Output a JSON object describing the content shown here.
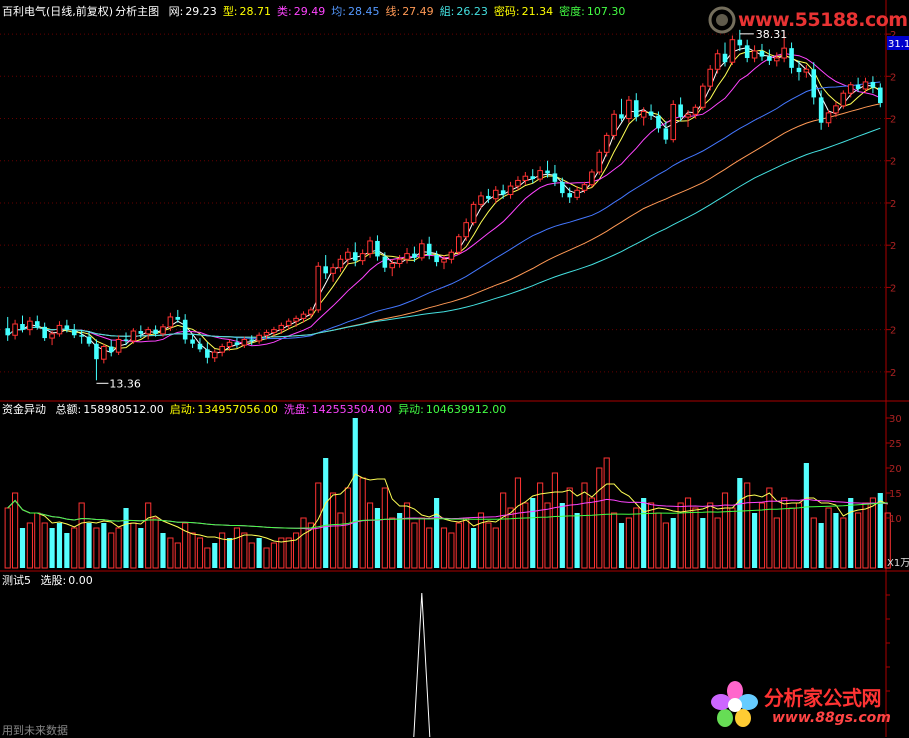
{
  "watermark_top": {
    "site": "www.55188.com"
  },
  "watermark_bottom": {
    "brand": "分析家公式网",
    "site": "www.88gs.com"
  },
  "panels": {
    "main": {
      "title": "百利电气(日线,前复权)",
      "subtitle": "分析主图",
      "indicators": [
        {
          "label": "网:",
          "value": "29.23",
          "color": "#ffffff"
        },
        {
          "label": "型:",
          "value": "28.71",
          "color": "#ffff00"
        },
        {
          "label": "类:",
          "value": "29.49",
          "color": "#ff44ff"
        },
        {
          "label": "均:",
          "value": "28.45",
          "color": "#5599ff"
        },
        {
          "label": "线:",
          "value": "27.49",
          "color": "#ff9955"
        },
        {
          "label": "組:",
          "value": "26.23",
          "color": "#44e0e0"
        },
        {
          "label": "密码:",
          "value": "21.34",
          "color": "#ffff00"
        },
        {
          "label": "密度:",
          "value": "107.30",
          "color": "#44ff44"
        }
      ],
      "high_marker": "38.31",
      "low_marker": "13.36",
      "price_tag": "31.1"
    },
    "volume": {
      "title": "资金异动",
      "indicators": [
        {
          "label": "总额:",
          "value": "158980512.00",
          "color": "#ffffff"
        },
        {
          "label": "启动:",
          "value": "134957056.00",
          "color": "#ffff00"
        },
        {
          "label": "洗盘:",
          "value": "142553504.00",
          "color": "#ff44ff"
        },
        {
          "label": "异动:",
          "value": "104639912.00",
          "color": "#44ff44"
        }
      ],
      "axis_ticks": [
        "30",
        "25",
        "20",
        "15",
        "10"
      ],
      "unit_label": "X1万"
    },
    "signal": {
      "title": "测试5",
      "indicators": [
        {
          "label": "选股:",
          "value": "0.00",
          "color": "#ffffff"
        }
      ],
      "footer_text": "用到未来数据"
    }
  },
  "chart_data": [
    {
      "type": "candlestick",
      "title": "百利电气(日线,前复权)",
      "price_range": [
        12,
        39
      ],
      "annotations": [
        {
          "label": "38.31",
          "kind": "high"
        },
        {
          "label": "13.36",
          "kind": "low"
        }
      ],
      "series": [
        {
          "name": "网",
          "last": 29.23
        },
        {
          "name": "型",
          "last": 28.71
        },
        {
          "name": "类",
          "last": 29.49
        },
        {
          "name": "均",
          "last": 28.45
        },
        {
          "name": "线",
          "last": 27.49
        },
        {
          "name": "組",
          "last": 26.23
        }
      ],
      "ohlc": [
        [
          17.1,
          17.9,
          16.2,
          16.6
        ],
        [
          16.6,
          17.7,
          16.3,
          17.4
        ],
        [
          17.4,
          18.0,
          16.8,
          17.0
        ],
        [
          17.0,
          17.9,
          16.6,
          17.6
        ],
        [
          17.6,
          18.0,
          17.0,
          17.2
        ],
        [
          17.2,
          17.5,
          16.2,
          16.4
        ],
        [
          16.4,
          16.9,
          15.9,
          16.7
        ],
        [
          16.7,
          17.6,
          16.5,
          17.3
        ],
        [
          17.3,
          17.7,
          16.8,
          17.0
        ],
        [
          17.0,
          17.4,
          16.4,
          16.6
        ],
        [
          16.6,
          17.0,
          16.0,
          16.5
        ],
        [
          16.5,
          16.9,
          15.8,
          16.0
        ],
        [
          16.0,
          16.3,
          13.4,
          14.9
        ],
        [
          14.9,
          16.0,
          14.6,
          15.8
        ],
        [
          15.8,
          16.3,
          15.1,
          15.4
        ],
        [
          15.4,
          16.6,
          15.2,
          16.3
        ],
        [
          16.3,
          16.8,
          15.9,
          16.2
        ],
        [
          16.2,
          17.1,
          16.0,
          16.9
        ],
        [
          16.9,
          17.3,
          16.4,
          16.7
        ],
        [
          16.7,
          17.2,
          16.3,
          17.0
        ],
        [
          17.0,
          17.3,
          16.5,
          16.7
        ],
        [
          16.7,
          17.4,
          16.5,
          17.2
        ],
        [
          17.2,
          18.2,
          16.9,
          17.9
        ],
        [
          17.9,
          18.4,
          17.5,
          17.7
        ],
        [
          17.7,
          18.1,
          16.0,
          16.3
        ],
        [
          16.3,
          16.7,
          15.7,
          16.0
        ],
        [
          16.0,
          16.4,
          15.4,
          15.6
        ],
        [
          15.6,
          16.1,
          14.6,
          15.0
        ],
        [
          15.0,
          15.6,
          14.7,
          15.4
        ],
        [
          15.4,
          16.0,
          15.1,
          15.8
        ],
        [
          15.8,
          16.3,
          15.5,
          16.1
        ],
        [
          16.1,
          16.4,
          15.7,
          15.9
        ],
        [
          15.9,
          16.5,
          15.7,
          16.3
        ],
        [
          16.3,
          16.6,
          15.9,
          16.2
        ],
        [
          16.2,
          16.8,
          16.0,
          16.6
        ],
        [
          16.6,
          17.0,
          16.3,
          16.8
        ],
        [
          16.8,
          17.2,
          16.5,
          17.0
        ],
        [
          17.0,
          17.5,
          16.7,
          17.3
        ],
        [
          17.3,
          17.8,
          17.0,
          17.6
        ],
        [
          17.6,
          18.0,
          17.2,
          17.8
        ],
        [
          17.8,
          18.3,
          17.5,
          18.1
        ],
        [
          18.1,
          18.6,
          17.8,
          18.4
        ],
        [
          18.4,
          21.8,
          18.2,
          21.5
        ],
        [
          21.5,
          22.3,
          20.6,
          21.0
        ],
        [
          21.0,
          21.7,
          20.4,
          21.4
        ],
        [
          21.4,
          22.3,
          21.1,
          22.0
        ],
        [
          22.0,
          22.8,
          21.6,
          22.5
        ],
        [
          22.5,
          23.2,
          21.5,
          21.9
        ],
        [
          21.9,
          22.7,
          21.6,
          22.4
        ],
        [
          22.4,
          23.6,
          22.1,
          23.3
        ],
        [
          23.3,
          23.7,
          21.9,
          22.2
        ],
        [
          22.2,
          22.5,
          21.1,
          21.4
        ],
        [
          21.4,
          22.0,
          20.8,
          21.7
        ],
        [
          21.7,
          22.3,
          21.4,
          22.0
        ],
        [
          22.0,
          22.8,
          21.7,
          22.4
        ],
        [
          22.4,
          22.9,
          21.8,
          22.1
        ],
        [
          22.1,
          23.4,
          21.9,
          23.1
        ],
        [
          23.1,
          23.6,
          22.0,
          22.3
        ],
        [
          22.3,
          22.6,
          21.5,
          21.8
        ],
        [
          21.8,
          22.3,
          21.3,
          22.0
        ],
        [
          22.0,
          22.7,
          21.7,
          22.5
        ],
        [
          22.5,
          23.8,
          22.3,
          23.6
        ],
        [
          23.6,
          24.9,
          23.3,
          24.6
        ],
        [
          24.6,
          26.1,
          24.4,
          25.9
        ],
        [
          25.9,
          26.8,
          25.6,
          26.5
        ],
        [
          26.5,
          27.0,
          26.0,
          26.3
        ],
        [
          26.3,
          27.2,
          26.0,
          26.9
        ],
        [
          26.9,
          27.3,
          26.3,
          26.6
        ],
        [
          26.6,
          27.5,
          26.3,
          27.2
        ],
        [
          27.2,
          27.9,
          26.9,
          27.6
        ],
        [
          27.6,
          28.2,
          27.3,
          27.9
        ],
        [
          27.9,
          28.4,
          27.4,
          27.7
        ],
        [
          27.7,
          28.6,
          27.5,
          28.3
        ],
        [
          28.3,
          29.0,
          27.8,
          28.1
        ],
        [
          28.1,
          28.7,
          27.2,
          27.5
        ],
        [
          27.5,
          27.8,
          26.4,
          26.7
        ],
        [
          26.7,
          27.1,
          26.0,
          26.4
        ],
        [
          26.4,
          27.2,
          26.2,
          26.9
        ],
        [
          26.9,
          27.5,
          26.7,
          27.3
        ],
        [
          27.3,
          28.4,
          27.1,
          28.2
        ],
        [
          28.2,
          29.8,
          28.0,
          29.6
        ],
        [
          29.6,
          31.0,
          29.3,
          30.8
        ],
        [
          30.8,
          32.6,
          30.5,
          32.3
        ],
        [
          32.3,
          33.4,
          31.8,
          32.0
        ],
        [
          32.0,
          33.6,
          31.7,
          33.3
        ],
        [
          33.3,
          33.8,
          31.8,
          32.1
        ],
        [
          32.1,
          32.8,
          31.5,
          32.5
        ],
        [
          32.5,
          33.0,
          31.9,
          32.2
        ],
        [
          32.2,
          32.5,
          31.0,
          31.3
        ],
        [
          31.3,
          31.8,
          30.2,
          30.5
        ],
        [
          30.5,
          33.3,
          30.3,
          33.0
        ],
        [
          33.0,
          33.5,
          31.8,
          32.1
        ],
        [
          32.1,
          32.6,
          31.4,
          32.3
        ],
        [
          32.3,
          33.0,
          32.0,
          32.8
        ],
        [
          32.8,
          34.5,
          32.6,
          34.3
        ],
        [
          34.3,
          35.8,
          34.0,
          35.5
        ],
        [
          35.5,
          36.9,
          35.2,
          36.6
        ],
        [
          36.6,
          37.4,
          35.7,
          36.0
        ],
        [
          36.0,
          37.9,
          35.8,
          37.6
        ],
        [
          37.6,
          38.3,
          36.8,
          37.2
        ],
        [
          37.2,
          37.6,
          36.0,
          36.3
        ],
        [
          36.3,
          37.2,
          36.0,
          36.8
        ],
        [
          36.8,
          37.3,
          36.1,
          36.4
        ],
        [
          36.4,
          36.9,
          35.8,
          36.1
        ],
        [
          36.1,
          36.7,
          35.7,
          36.3
        ],
        [
          36.3,
          38.2,
          36.0,
          37.0
        ],
        [
          37.0,
          37.4,
          35.2,
          35.6
        ],
        [
          35.6,
          36.1,
          34.7,
          35.3
        ],
        [
          35.3,
          35.8,
          34.9,
          35.5
        ],
        [
          35.5,
          36.0,
          33.0,
          33.5
        ],
        [
          33.5,
          34.0,
          31.2,
          31.7
        ],
        [
          31.7,
          32.6,
          31.4,
          32.4
        ],
        [
          32.4,
          33.2,
          32.1,
          32.9
        ],
        [
          32.9,
          34.0,
          32.7,
          33.8
        ],
        [
          33.8,
          34.6,
          33.5,
          34.4
        ],
        [
          34.4,
          34.9,
          33.9,
          34.1
        ],
        [
          34.1,
          34.9,
          33.8,
          34.6
        ],
        [
          34.6,
          35.0,
          33.8,
          34.2
        ],
        [
          34.2,
          34.5,
          32.8,
          33.1
        ]
      ]
    },
    {
      "type": "bar",
      "title": "资金异动",
      "ylim": [
        0,
        30
      ],
      "y_ticks": [
        30,
        25,
        20,
        15,
        10
      ],
      "unit": "X1万",
      "series": [
        {
          "name": "总额",
          "last": 158980512.0
        },
        {
          "name": "启动",
          "last": 134957056.0
        },
        {
          "name": "洗盘",
          "last": 142553504.0
        },
        {
          "name": "异动",
          "last": 104639912.0
        }
      ],
      "values": [
        12,
        15,
        8,
        9,
        11,
        9,
        8,
        9,
        7,
        8,
        13,
        9,
        8,
        9,
        7,
        8,
        12,
        9,
        8,
        13,
        10,
        7,
        6,
        5,
        9,
        7,
        6,
        4,
        5,
        7,
        6,
        8,
        7,
        5,
        6,
        4,
        5,
        6,
        6,
        7,
        10,
        9,
        17,
        22,
        15,
        11,
        16,
        30,
        18,
        13,
        12,
        16,
        10,
        11,
        13,
        9,
        10,
        8,
        14,
        8,
        7,
        9,
        10,
        8,
        11,
        9,
        8,
        15,
        12,
        18,
        13,
        14,
        17,
        13,
        19,
        13,
        16,
        11,
        17,
        14,
        20,
        22,
        11,
        9,
        10,
        12,
        14,
        13,
        11,
        9,
        10,
        13,
        14,
        12,
        10,
        13,
        10,
        15,
        12,
        18,
        17,
        11,
        13,
        16,
        10,
        14,
        12,
        13,
        21,
        10,
        9,
        12,
        11,
        10,
        14,
        11,
        13,
        14,
        15,
        11
      ],
      "signal_bars": [
        2,
        6,
        7,
        8,
        11,
        13,
        16,
        18,
        21,
        28,
        30,
        34,
        43,
        47,
        50,
        53,
        58,
        63,
        71,
        75,
        77,
        83,
        86,
        90,
        94,
        99,
        101,
        108,
        110,
        112,
        114,
        118
      ]
    },
    {
      "type": "line",
      "title": "测试5",
      "ylim": [
        0,
        1
      ],
      "series": [
        {
          "name": "选股",
          "last": 0.0
        }
      ],
      "spike_index": 56
    }
  ]
}
